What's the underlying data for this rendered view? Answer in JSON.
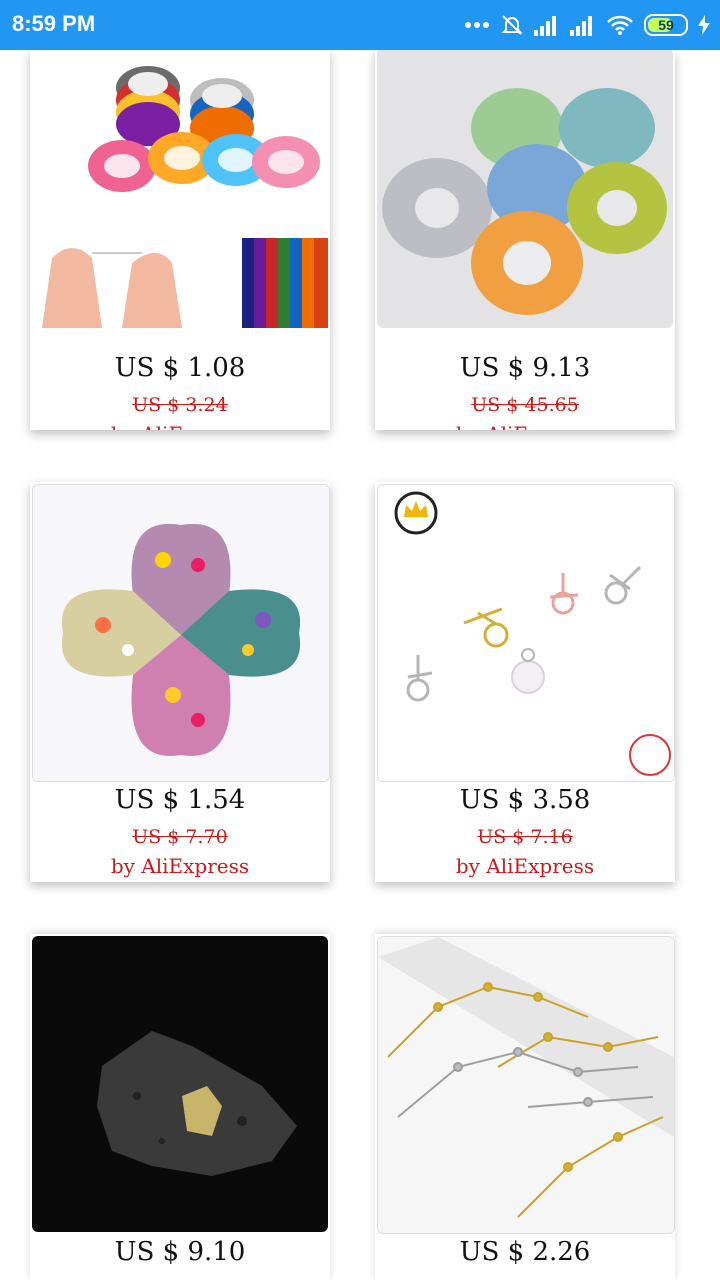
{
  "status_bar": {
    "time": "8:59 PM",
    "battery": "59"
  },
  "products": [
    {
      "price": "US $ 1.08",
      "old_price": "US $ 3.24",
      "seller": "by AliExpress"
    },
    {
      "price": "US $ 9.13",
      "old_price": "US $ 45.65",
      "seller": "by AliExpress"
    },
    {
      "price": "US $ 1.54",
      "old_price": "US $ 7.70",
      "seller": "by AliExpress"
    },
    {
      "price": "US $ 3.58",
      "old_price": "US $ 7.16",
      "seller": "by AliExpress"
    },
    {
      "price": "US $ 9.10",
      "old_price": "",
      "seller": ""
    },
    {
      "price": "US $ 2.26",
      "old_price": "",
      "seller": ""
    }
  ],
  "colors": {
    "status_bar": "#2196f3",
    "sale_red": "#cc1a1a"
  }
}
